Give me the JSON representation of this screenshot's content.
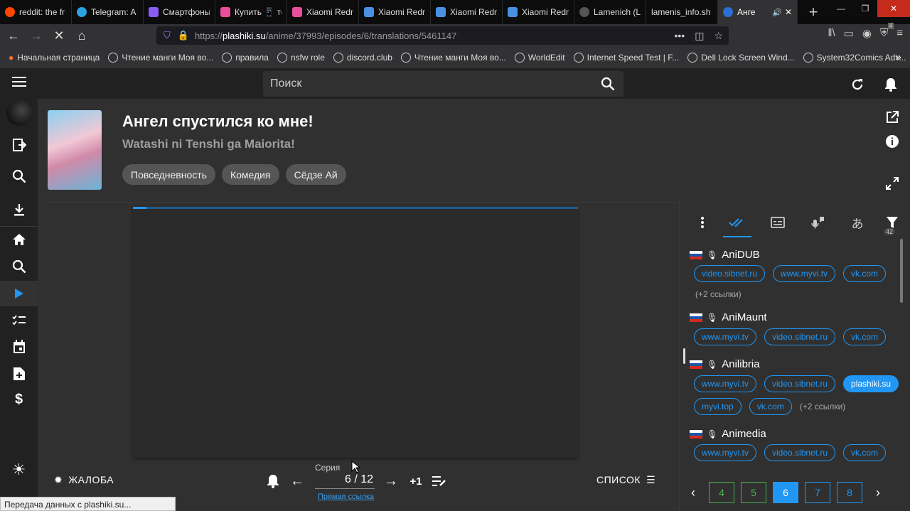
{
  "browser": {
    "tabs": [
      {
        "label": "reddit: the fr",
        "color": "#ff4500"
      },
      {
        "label": "Telegram: A",
        "color": "#2aa3e0"
      },
      {
        "label": "Смартфоны",
        "color": "#8a5cf6"
      },
      {
        "label": "Купить 📱 тел",
        "color": "#e94e9a"
      },
      {
        "label": "Xiaomi Redm",
        "color": "#e94e9a"
      },
      {
        "label": "Xiaomi Redm",
        "color": "#4a90e2"
      },
      {
        "label": "Xiaomi Redm",
        "color": "#4a90e2"
      },
      {
        "label": "Xiaomi Redm",
        "color": "#4a90e2"
      },
      {
        "label": "Lamenich (L",
        "color": "#555555"
      },
      {
        "label": "lamenis_info.sh",
        "color": "#0c0c0d"
      },
      {
        "label": "Анге",
        "color": "#2b6fd6"
      }
    ],
    "url_prefix": "https://",
    "url_host": "plashiki.su",
    "url_path": "/anime/37993/episodes/6/translations/5461147",
    "bookmarks": [
      "Начальная страница",
      "Чтение манги Моя во...",
      "правила",
      "nsfw role",
      "discord.club",
      "Чтение манги Моя во...",
      "WorldEdit",
      "Internet Speed Test | F...",
      "Dell Lock Screen Wind...",
      "System32Comics Adv..."
    ],
    "status_text": "Передача данных с plashiki.su...",
    "addon_badge": "4"
  },
  "app": {
    "search_placeholder": "Поиск",
    "anime": {
      "title": "Ангел спустился ко мне!",
      "subtitle": "Watashi ni Tenshi ga Maiorita!",
      "genres": [
        "Повседневность",
        "Комедия",
        "Сёдзе Ай"
      ]
    },
    "player": {
      "progress_fraction": 0.03
    },
    "controls": {
      "complain_label": "ЖАЛОБА",
      "episode_label": "Серия",
      "episode_value": "6 / 12",
      "plus_one": "+1",
      "direct_link": "Прямая ссылка",
      "list_label": "СПИСОК"
    },
    "translations_panel": {
      "filter_count": "42",
      "studios": [
        {
          "name": "AniDUB",
          "links": [
            "video.sibnet.ru",
            "www.myvi.tv",
            "vk.com"
          ],
          "more": "(+2 ссылки)"
        },
        {
          "name": "AniMaunt",
          "links": [
            "www.myvi.tv",
            "video.sibnet.ru",
            "vk.com"
          ],
          "more": ""
        },
        {
          "name": "Anilibria",
          "links": [
            "www.myvi.tv",
            "video.sibnet.ru",
            "plashiki.su"
          ],
          "links2": [
            "myvi.top",
            "vk.com"
          ],
          "more": "(+2 ссылки)"
        },
        {
          "name": "Animedia",
          "links": [
            "www.myvi.tv",
            "video.sibnet.ru",
            "vk.com"
          ],
          "more": ""
        }
      ],
      "pages": [
        "4",
        "5",
        "6",
        "7",
        "8"
      ],
      "current_page": "6"
    }
  }
}
